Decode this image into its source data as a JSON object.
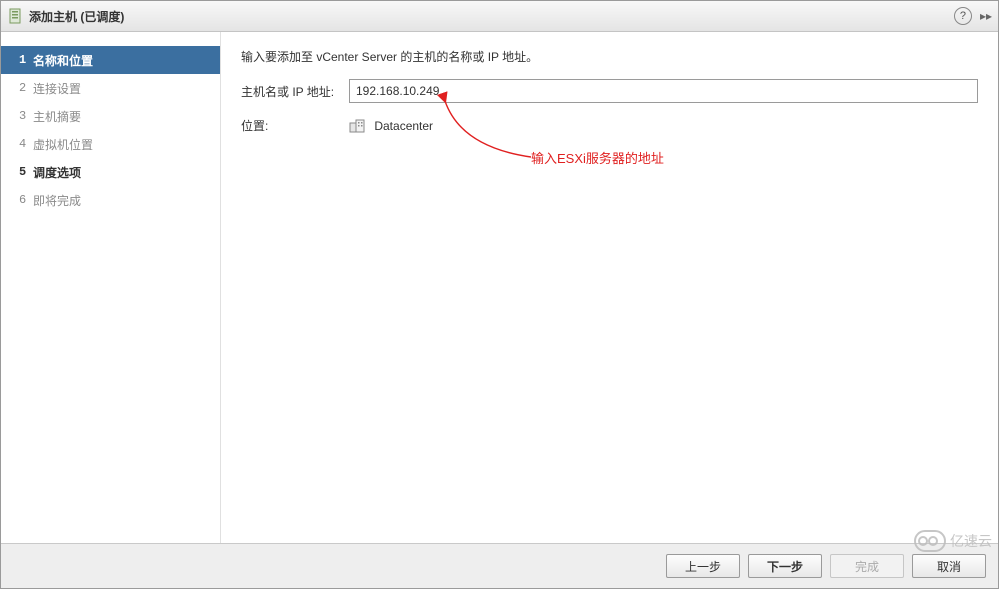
{
  "titlebar": {
    "title": "添加主机 (已调度)"
  },
  "sidebar": {
    "items": [
      {
        "num": "1",
        "label": "名称和位置"
      },
      {
        "num": "2",
        "label": "连接设置"
      },
      {
        "num": "3",
        "label": "主机摘要"
      },
      {
        "num": "4",
        "label": "虚拟机位置"
      },
      {
        "num": "5",
        "label": "调度选项"
      },
      {
        "num": "6",
        "label": "即将完成"
      }
    ]
  },
  "main": {
    "instruction": "输入要添加至 vCenter Server 的主机的名称或 IP 地址。",
    "host_label": "主机名或 IP 地址:",
    "host_value": "192.168.10.249",
    "location_label": "位置:",
    "location_value": "Datacenter"
  },
  "annotation": {
    "text": "输入ESXi服务器的地址"
  },
  "footer": {
    "back": "上一步",
    "next": "下一步",
    "finish": "完成",
    "cancel": "取消"
  },
  "watermark": {
    "text": "亿速云"
  }
}
